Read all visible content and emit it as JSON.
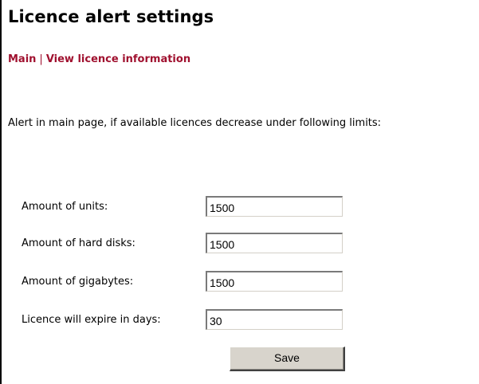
{
  "page": {
    "title": "Licence alert settings"
  },
  "nav": {
    "main": "Main",
    "separator": "|",
    "view_info": "View licence information",
    "link_color": "#a0112f"
  },
  "description": "Alert in main page, if available licences decrease under following limits:",
  "form": {
    "fields": [
      {
        "label": "Amount of units:",
        "value": "1500"
      },
      {
        "label": "Amount of hard disks:",
        "value": "1500"
      },
      {
        "label": "Amount of gigabytes:",
        "value": "1500"
      },
      {
        "label": "Licence will expire in days:",
        "value": "30"
      }
    ],
    "save_label": "Save"
  }
}
